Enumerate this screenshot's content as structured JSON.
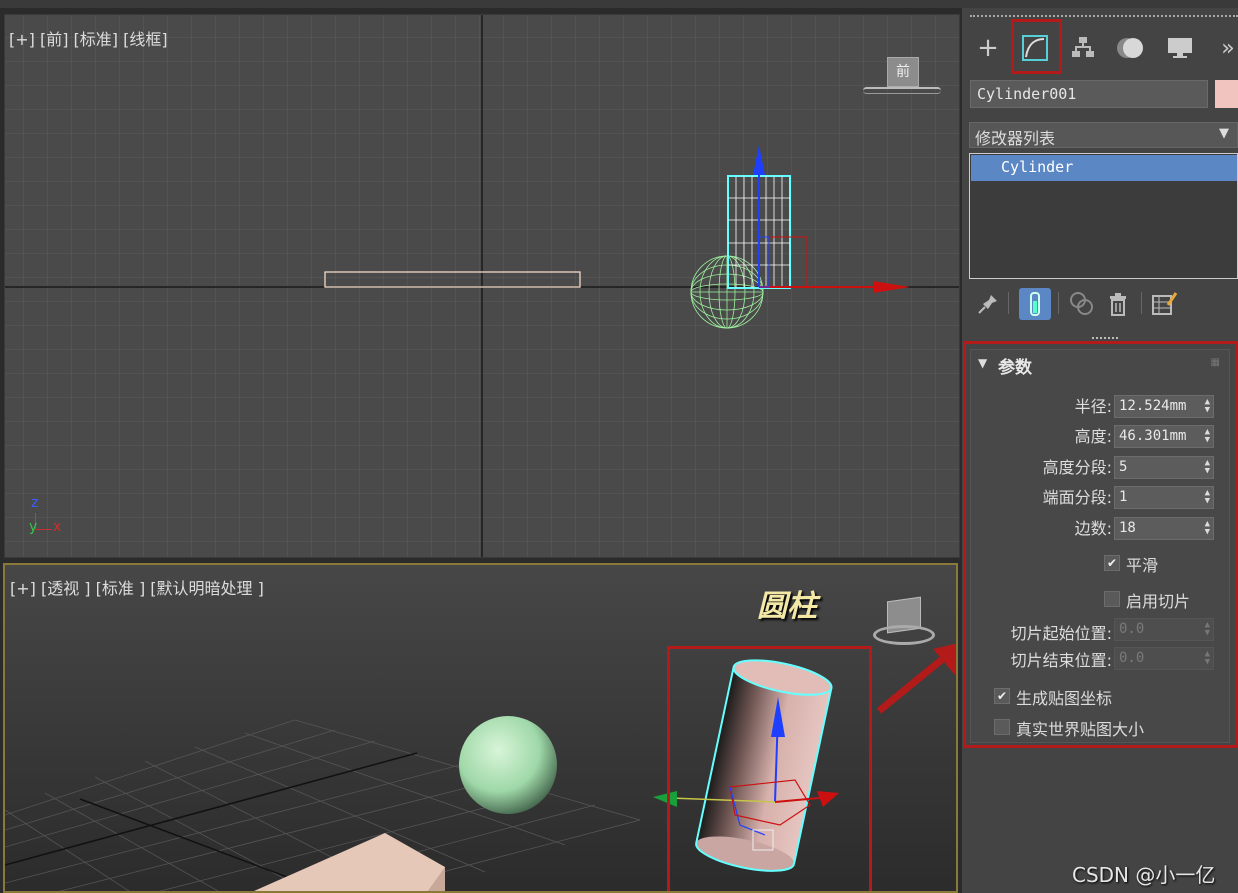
{
  "viewports": {
    "front": {
      "label": "[+] [前] [标准] [线框]",
      "viewcube_label": "前"
    },
    "perspective": {
      "label": "[+] [透视 ] [标准 ] [默认明暗处理 ]",
      "annotation": "圆柱"
    }
  },
  "axes": {
    "x": "x",
    "y": "y",
    "z": "z"
  },
  "panel": {
    "tabs": [
      "create-icon",
      "modify-icon",
      "hierarchy-icon",
      "motion-icon",
      "display-icon",
      "more-icon"
    ],
    "tab_more": "»",
    "object_name": "Cylinder001",
    "object_color": "#f2c4c0",
    "modifier_list_label": "修改器列表",
    "stack_items": [
      "Cylinder"
    ],
    "rollout_title": "参数",
    "params": [
      {
        "label": "半径:",
        "value": "12.524mm",
        "enabled": true
      },
      {
        "label": "高度:",
        "value": "46.301mm",
        "enabled": true
      },
      {
        "label": "高度分段:",
        "value": "5",
        "enabled": true
      },
      {
        "label": "端面分段:",
        "value": "1",
        "enabled": true
      },
      {
        "label": "边数:",
        "value": "18",
        "enabled": true
      }
    ],
    "smooth": {
      "label": "平滑",
      "checked": true
    },
    "slice_on": {
      "label": "启用切片",
      "checked": false
    },
    "slice_from": {
      "label": "切片起始位置:",
      "value": "0.0",
      "enabled": false
    },
    "slice_to": {
      "label": "切片结束位置:",
      "value": "0.0",
      "enabled": false
    },
    "gen_mapping": {
      "label": "生成贴图坐标",
      "checked": true
    },
    "real_world": {
      "label": "真实世界贴图大小",
      "checked": false
    }
  },
  "watermark": "CSDN @小一亿",
  "colors": {
    "highlight_red": "#b31a1a",
    "selection_blue": "#5b87c5",
    "wire_cyan": "#5ff",
    "sphere_green": "#9fd8a8",
    "box_beige": "#e6c8b8"
  }
}
